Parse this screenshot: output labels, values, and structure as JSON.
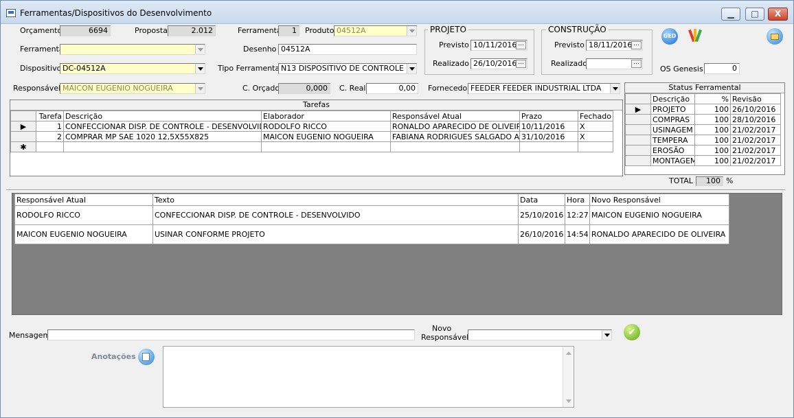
{
  "window": {
    "title": "Ferramentas/Dispositivos do Desenvolvimento",
    "minimize": "▁",
    "maximize": "□",
    "close": "X"
  },
  "form": {
    "orcamento_label": "Orçamento",
    "orcamento_value": "6694",
    "proposta_label": "Proposta",
    "proposta_value": "2.012",
    "ferramental_label": "Ferramental",
    "ferramental_value": "1",
    "produto_label": "Produto",
    "produto_value": "04512A",
    "ferramenta_label": "Ferramenta",
    "ferramenta_value": "",
    "desenho_label": "Desenho",
    "desenho_value": "04512A",
    "dispositivo_label": "Dispositivo",
    "dispositivo_value": "DC-04512A",
    "tipo_ferramental_label": "Tipo Ferramental",
    "tipo_ferramental_value": "N13  DISPOSITIVO DE CONTROLE",
    "responsavel_label": "Responsável",
    "responsavel_value": "MAICON EUGENIO NOGUEIRA",
    "c_orcado_label": "C. Orçado",
    "c_orcado_value": "0,000",
    "c_real_label": "C. Real",
    "c_real_value": "0,00",
    "fornecedor_label": "Fornecedor",
    "fornecedor_value": "FEEDER   FEEDER INDUSTRIAL LTDA",
    "os_genesis_label": "OS Genesis",
    "os_genesis_value": "0"
  },
  "projeto": {
    "title": "PROJETO",
    "previsto_label": "Previsto",
    "previsto_value": "10/11/2016",
    "realizado_label": "Realizado",
    "realizado_value": "26/10/2016",
    "date_button": "..."
  },
  "construcao": {
    "title": "CONSTRUÇÃO",
    "previsto_label": "Previsto",
    "previsto_value": "18/11/2016",
    "realizado_label": "Realizado",
    "realizado_value": ""
  },
  "toolbar": {
    "ged_label": "GED"
  },
  "tarefas": {
    "caption": "Tarefas",
    "headers": [
      "Tarefa",
      "Descrição",
      "Elaborador",
      "Responsável Atual",
      "Prazo",
      "Fechado"
    ],
    "rows": [
      {
        "tarefa": "1",
        "descricao": "CONFECCIONAR DISP. DE CONTROLE - DESENVOLVIDO",
        "elaborador": "RODOLFO RICCO",
        "responsavel": "RONALDO APARECIDO DE OLIVEIRA",
        "prazo": "10/11/2016",
        "fechado": "X"
      },
      {
        "tarefa": "2",
        "descricao": "COMPRAR MP SAE 1020 12,5X55X825",
        "elaborador": "MAICON EUGENIO NOGUEIRA",
        "responsavel": "FABIANA RODRIGUES SALGADO ANDRADE",
        "prazo": "31/10/2016",
        "fechado": "X"
      }
    ],
    "current_marker": "▶",
    "new_marker": "✱"
  },
  "status": {
    "caption": "Status Ferramental",
    "headers": [
      "Descrição",
      "%",
      "Revisão"
    ],
    "rows": [
      {
        "desc": "PROJETO",
        "pct": "100",
        "rev": "26/10/2016"
      },
      {
        "desc": "COMPRAS",
        "pct": "100",
        "rev": "28/10/2016"
      },
      {
        "desc": "USINAGEM",
        "pct": "100",
        "rev": "21/02/2017"
      },
      {
        "desc": "TEMPERA",
        "pct": "100",
        "rev": "21/02/2017"
      },
      {
        "desc": "EROSÃO",
        "pct": "100",
        "rev": "21/02/2017"
      },
      {
        "desc": "MONTAGEM",
        "pct": "100",
        "rev": "21/02/2017"
      }
    ],
    "total_label": "TOTAL",
    "total_value": "100",
    "total_unit": "%"
  },
  "historico": {
    "headers": [
      "Responsável Atual",
      "Texto",
      "Data",
      "Hora",
      "Novo Responsável"
    ],
    "rows": [
      {
        "resp": "RODOLFO RICCO",
        "texto": "CONFECCIONAR DISP. DE CONTROLE - DESENVOLVIDO",
        "data": "25/10/2016",
        "hora": "12:27",
        "novo": "MAICON EUGENIO NOGUEIRA"
      },
      {
        "resp": "MAICON EUGENIO NOGUEIRA",
        "texto": "USINAR CONFORME PROJETO",
        "data": "26/10/2016",
        "hora": "14:54",
        "novo": "RONALDO APARECIDO DE OLIVEIRA"
      }
    ]
  },
  "footer": {
    "mensagem_label": "Mensagem",
    "mensagem_value": "",
    "novo_label": "Novo",
    "responsavel_label": "Responsável",
    "novo_responsavel_value": "",
    "anotacoes_label": "Anotações",
    "anotacoes_value": ""
  }
}
